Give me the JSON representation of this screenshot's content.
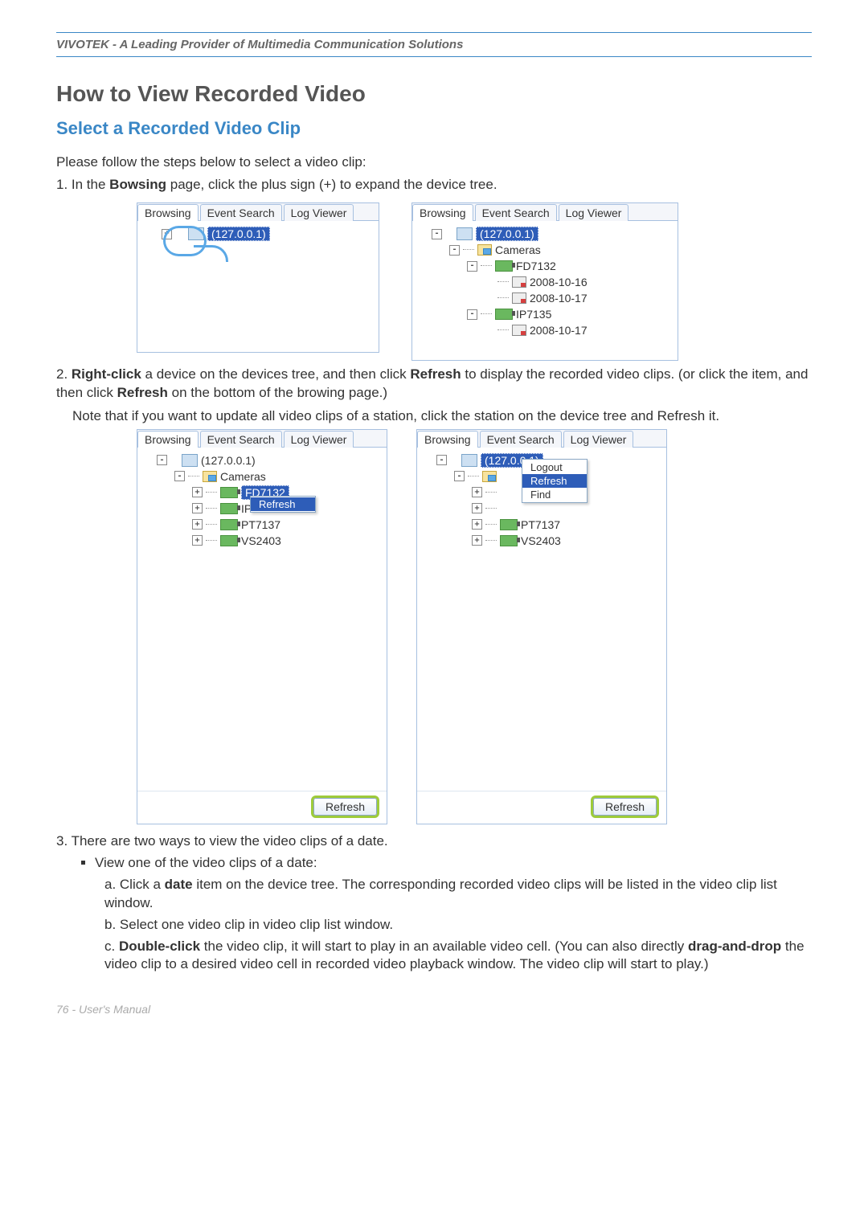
{
  "header": "VIVOTEK - A Leading Provider of Multimedia Communication Solutions",
  "title": "How to View Recorded Video",
  "subtitle": "Select a Recorded Video Clip",
  "intro": "Please follow the steps below to select a video clip:",
  "step1_pre": "1. In the ",
  "step1_bold": "Bowsing",
  "step1_post": " page, click the plus sign (+) to expand the device tree.",
  "tabs": {
    "browsing": "Browsing",
    "event_search": "Event Search",
    "log_viewer": "Log Viewer"
  },
  "ip": "(127.0.0.1)",
  "cameras": "Cameras",
  "cam1": "FD7132",
  "date1": "2008-10-16",
  "date2": "2008-10-17",
  "cam2": "IP7135",
  "date3": "2008-10-17",
  "step2_pre": "2. ",
  "step2_b1": "Right-click",
  "step2_mid1": " a device on the devices tree, and then click ",
  "step2_b2": "Refresh",
  "step2_mid2": " to display the recorded video clips. (or click the item, and then click ",
  "step2_b3": "Refresh",
  "step2_post": " on the bottom of the browing page.)",
  "note": "Note that if you want to update all video clips of a station, click the station on the device tree and Refresh it.",
  "cam3": "PT7137",
  "cam4": "VS2403",
  "ctx_refresh": "Refresh",
  "ctx_logout": "Logout",
  "ctx_find": "Find",
  "ip_short": "IP",
  "refresh_btn": "Refresh",
  "step3": "3. There are two ways to view the video clips of a date.",
  "bullet1": "View one of the video clips of a date:",
  "sub_a_pre": "a. Click a ",
  "sub_a_bold": "date",
  "sub_a_post": " item on the device tree. The corresponding recorded video clips will be listed in the video clip list window.",
  "sub_b": "b. Select one video clip in video clip list window.",
  "sub_c_pre": "c. ",
  "sub_c_b1": "Double-click",
  "sub_c_mid": " the video clip, it will start to play in an available video cell. (You can also directly ",
  "sub_c_b2": "drag-and-drop",
  "sub_c_post": " the video clip to a desired video cell in recorded video playback window. The video clip will start to play.)",
  "footer_page": "76 - ",
  "footer_label": "User's Manual"
}
